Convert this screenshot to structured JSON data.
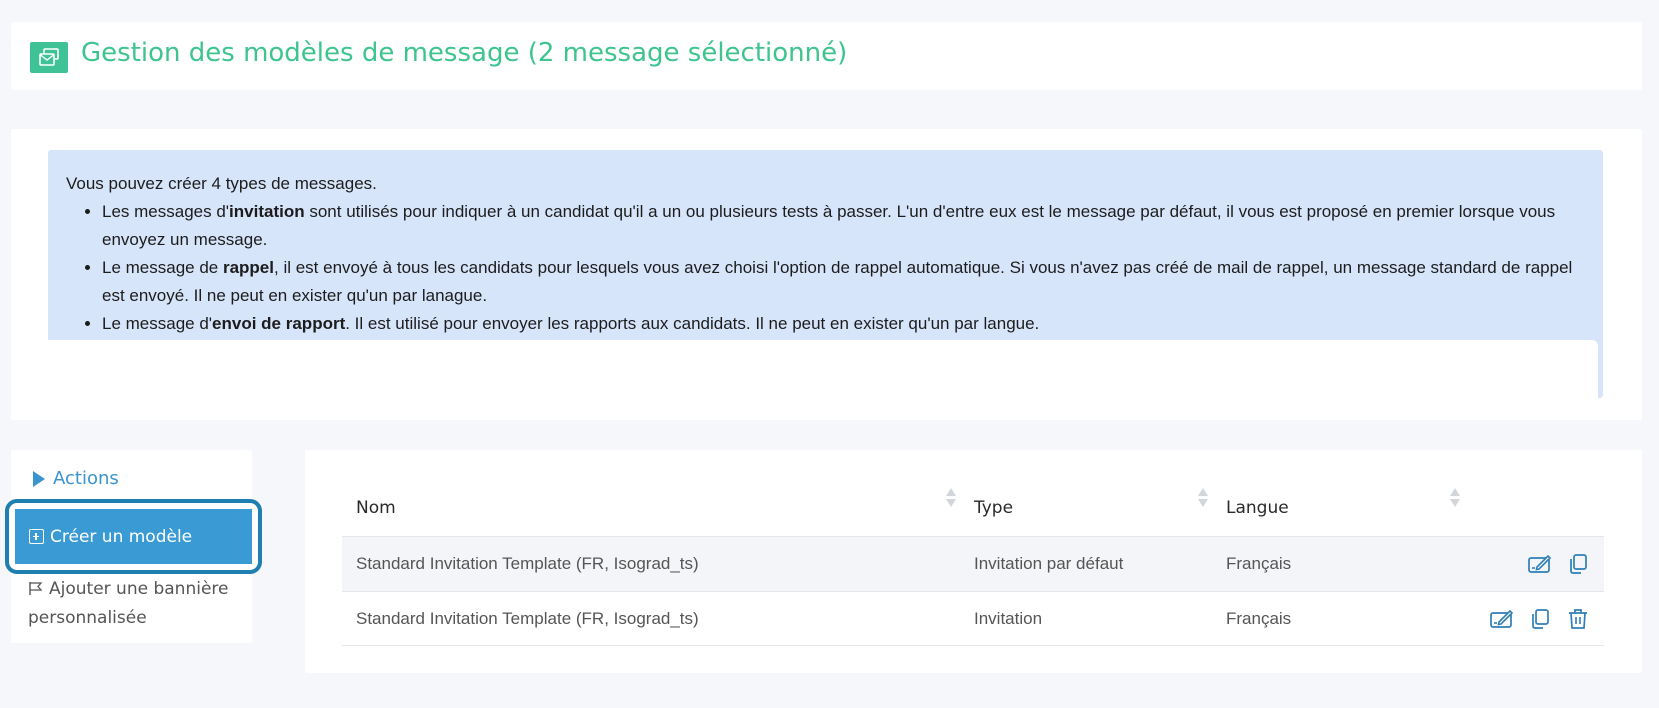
{
  "header": {
    "title": "Gestion des modèles de message (2 message sélectionné)",
    "icon": "templates-icon",
    "accent_color": "#3ec48e"
  },
  "info": {
    "intro": "Vous pouvez créer 4 types de messages.",
    "items": [
      {
        "before": "Les messages d'",
        "bold": "invitation",
        "after": " sont utilisés pour indiquer à un candidat qu'il a un ou plusieurs tests à passer. L'un d'entre eux est le message par défaut, il vous est proposé en premier lorsque vous envoyez un message."
      },
      {
        "before": "Le message de ",
        "bold": "rappel",
        "after": ", il est envoyé à tous les candidats pour lesquels vous avez choisi l'option de rappel automatique. Si vous n'avez pas créé de mail de rappel, un message standard de rappel est envoyé. Il ne peut en exister qu'un par lanague."
      },
      {
        "before": "Le message d'",
        "bold": "envoi de rapport",
        "after": ". Il est utilisé pour envoyer les rapports aux candidats. Il ne peut en exister qu'un par langue."
      }
    ],
    "background_color": "#d7e5fb"
  },
  "actions": {
    "title": "Actions",
    "create_label": "Créer un modèle",
    "banner_label": "Ajouter une bannière personnalisée",
    "accent_color": "#3a94cf"
  },
  "table": {
    "columns": [
      "Nom",
      "Type",
      "Langue"
    ],
    "rows": [
      {
        "name": "Standard Invitation Template (FR, Isograd_ts)",
        "type": "Invitation par défaut",
        "language": "Français",
        "actions": [
          "edit-icon",
          "copy-icon"
        ]
      },
      {
        "name": "Standard Invitation Template (FR, Isograd_ts)",
        "type": "Invitation",
        "language": "Français",
        "actions": [
          "edit-icon",
          "copy-icon",
          "trash-icon"
        ]
      }
    ],
    "icon_color": "#2f7fb8"
  }
}
